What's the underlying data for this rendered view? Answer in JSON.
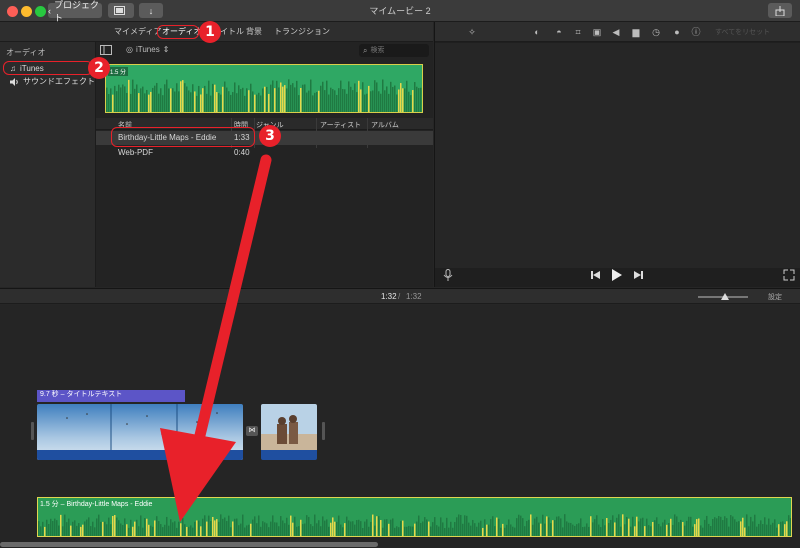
{
  "window": {
    "title": "マイムービー 2",
    "back_label": "プロジェクト"
  },
  "browser_tabs": [
    {
      "label": "マイメディア"
    },
    {
      "label": "オーディオ"
    },
    {
      "label": "タイトル"
    },
    {
      "label": "背景"
    },
    {
      "label": "トランジション"
    }
  ],
  "sidebar": {
    "header": "オーディオ",
    "items": [
      {
        "label": "iTunes",
        "icon": "music-note-icon"
      },
      {
        "label": "サウンドエフェクト",
        "icon": "speaker-icon"
      }
    ]
  },
  "library": {
    "source_label": "iTunes",
    "search_placeholder": "検索",
    "preview_duration": "1.5 分",
    "columns": [
      "名前",
      "時間",
      "ジャンル",
      "アーティスト",
      "アルバム"
    ],
    "rows": [
      {
        "name": "Birthday-Little Maps - Eddie",
        "time": "1:33"
      },
      {
        "name": "Web-PDF",
        "time": "0:40"
      }
    ]
  },
  "viewer": {
    "reset_all": "すべてをリセット"
  },
  "timeline": {
    "current_time": "1:32",
    "total_time": "1:32",
    "separator": "/",
    "settings_label": "設定",
    "zoom_level": 0.53,
    "title_clip_label": "9.7 秒 – タイトルテキスト",
    "audio_clip_label": "1.5 分 – Birthday-Little Maps - Eddie"
  },
  "annotations": [
    "1",
    "2",
    "3"
  ],
  "colors": {
    "accent_red": "#e8212a",
    "audio_green": "#2b9c56",
    "audio_border": "#e0d650",
    "title_purple": "#5c55c7"
  }
}
